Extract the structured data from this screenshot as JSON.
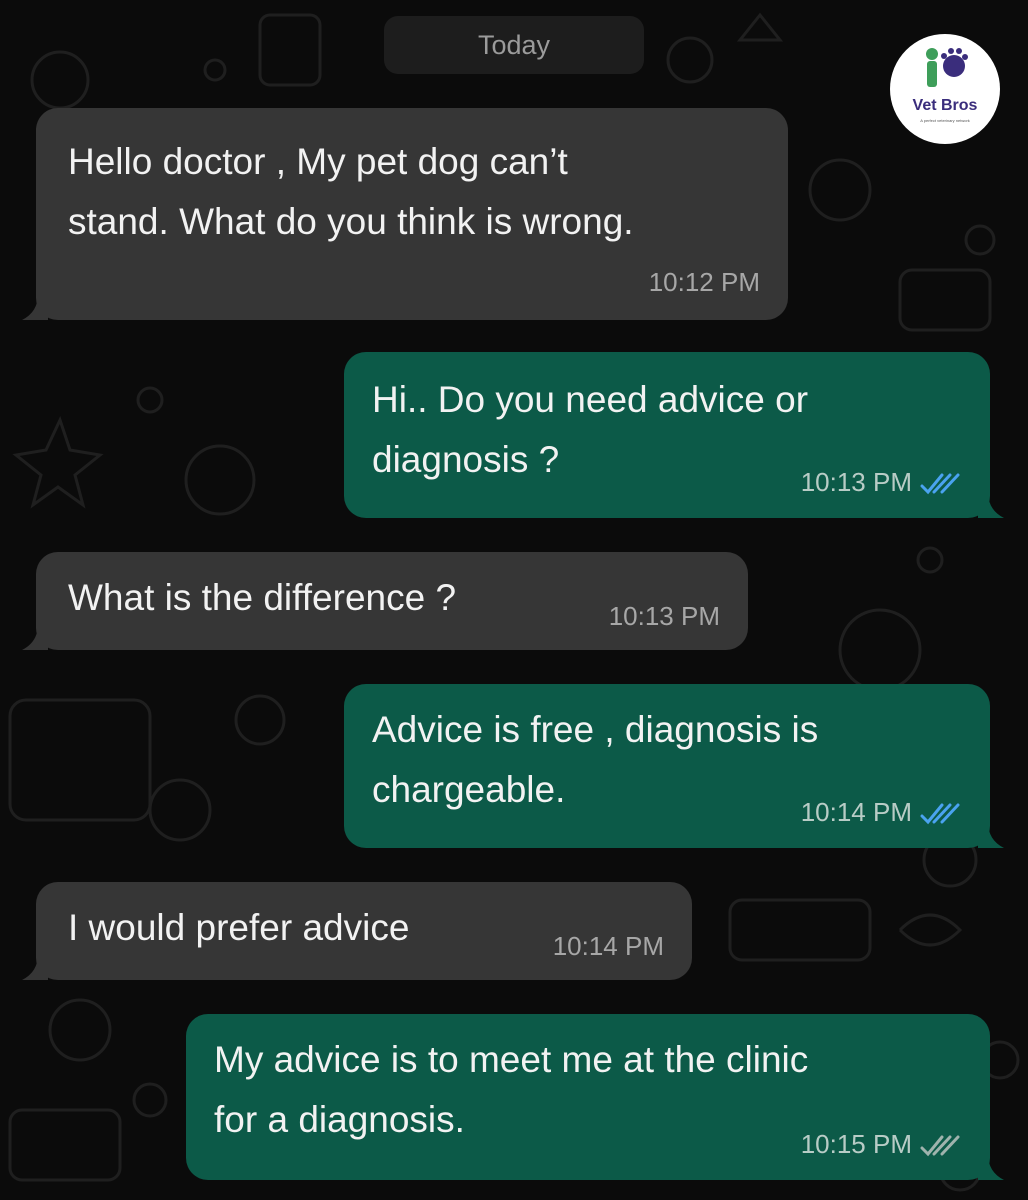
{
  "date_separator": "Today",
  "logo": {
    "name": "Vet Bros",
    "tagline": "A perfect veterinary network"
  },
  "colors": {
    "background": "#0b0b0b",
    "incoming_bubble": "#363636",
    "outgoing_bubble": "#0c5a48",
    "read_ticks": "#4aa3f0"
  },
  "messages": [
    {
      "direction": "incoming",
      "lines": [
        "Hello doctor , My pet dog can’t",
        "stand. What do you think is wrong."
      ],
      "time": "10:12 PM"
    },
    {
      "direction": "outgoing",
      "lines": [
        "Hi.. Do you need advice or",
        "diagnosis ?"
      ],
      "time": "10:13 PM",
      "status": "read"
    },
    {
      "direction": "incoming",
      "lines": [
        "What is the difference ?"
      ],
      "time": "10:13 PM"
    },
    {
      "direction": "outgoing",
      "lines": [
        "Advice is free , diagnosis is",
        "chargeable."
      ],
      "time": "10:14 PM",
      "status": "read"
    },
    {
      "direction": "incoming",
      "lines": [
        "I would prefer advice"
      ],
      "time": "10:14 PM"
    },
    {
      "direction": "outgoing",
      "lines": [
        "My advice is to meet me at the clinic",
        "for a diagnosis."
      ],
      "time": "10:15 PM",
      "status": "delivered"
    }
  ]
}
